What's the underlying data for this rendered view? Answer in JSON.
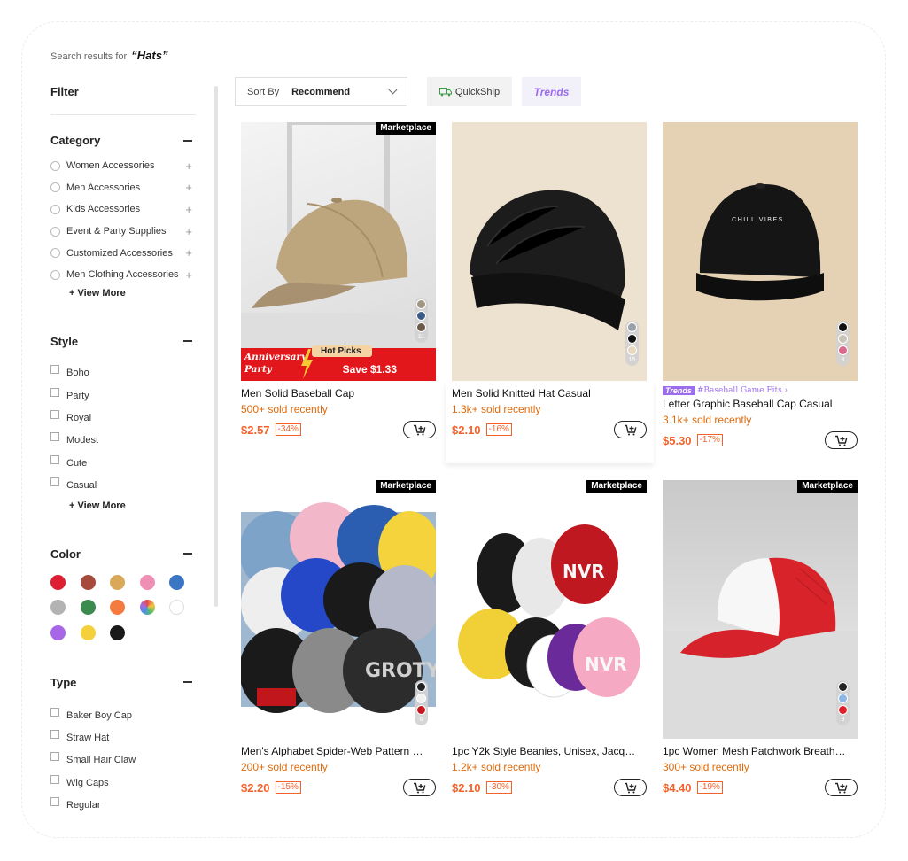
{
  "search": {
    "prefix": "Search results for",
    "query": "“Hats”"
  },
  "sidebar": {
    "filter_title": "Filter",
    "category": {
      "title": "Category",
      "items": [
        "Women Accessories",
        "Men Accessories",
        "Kids Accessories",
        "Event & Party Supplies",
        "Customized Accessories",
        "Men Clothing Accessories"
      ],
      "view_more": "+ View More"
    },
    "style": {
      "title": "Style",
      "items": [
        "Boho",
        "Party",
        "Royal",
        "Modest",
        "Cute",
        "Casual"
      ],
      "view_more": "+ View More"
    },
    "color": {
      "title": "Color",
      "swatches": [
        "#dc1f32",
        "#a64b3c",
        "#d9a859",
        "#ef8fb4",
        "#3b76c4",
        "#b3b3b3",
        "#3b8a4e",
        "#f47a3f",
        "multicolor",
        "#ffffff",
        "#a766e6",
        "#f4d13b",
        "#1a1a1a"
      ]
    },
    "type": {
      "title": "Type",
      "items": [
        "Baker Boy Cap",
        "Straw Hat",
        "Small Hair Claw",
        "Wig Caps",
        "Regular"
      ]
    }
  },
  "toolbar": {
    "sort_label": "Sort By",
    "sort_value": "Recommend",
    "quickship": "QuickShip",
    "trends": "Trends"
  },
  "products": [
    {
      "title": "Men Solid Baseball Cap",
      "sold": "500+ sold recently",
      "price": "$2.57",
      "discount": "-34%",
      "badge": "Marketplace",
      "colors": [
        "#a09682",
        "#3a5a86",
        "#6b5a49"
      ],
      "color_count": "11",
      "promo": {
        "line1": "Anniversary",
        "line2": "Party",
        "hot": "Hot Picks",
        "save": "Save $1.33"
      }
    },
    {
      "title": "Men Solid Knitted Hat Casual",
      "sold": "1.3k+ sold recently",
      "price": "$2.10",
      "discount": "-16%",
      "badge": "",
      "colors": [
        "#9aa0a8",
        "#111111",
        "#e8d8c0"
      ],
      "color_count": "15"
    },
    {
      "title": "Letter Graphic Baseball Cap Casual",
      "sold": "3.1k+ sold recently",
      "price": "$5.30",
      "discount": "-17%",
      "badge": "",
      "colors": [
        "#111111",
        "#c9c4b8",
        "#d96a8c"
      ],
      "color_count": "8",
      "trend": {
        "logo": "Trends",
        "hashtag": "#Baseball Game Fits ›"
      },
      "cap_text": "CHILL VIBES"
    },
    {
      "title": "Men's Alphabet Spider-Web Pattern …",
      "sold": "200+ sold recently",
      "price": "$2.20",
      "discount": "-15%",
      "badge": "Marketplace",
      "colors": [
        "#222222",
        "#f0f0f0",
        "#c4161c"
      ],
      "color_count": "6"
    },
    {
      "title": "1pc Y2k Style Beanies, Unisex, Jacq…",
      "sold": "1.2k+ sold recently",
      "price": "$2.10",
      "discount": "-30%",
      "badge": "Marketplace",
      "colors": [],
      "color_count": ""
    },
    {
      "title": "1pc Women Mesh Patchwork Breath…",
      "sold": "300+ sold recently",
      "price": "$4.40",
      "discount": "-19%",
      "badge": "Marketplace",
      "colors": [
        "#222222",
        "#8cb8e6",
        "#e0202a"
      ],
      "color_count": "9"
    }
  ]
}
